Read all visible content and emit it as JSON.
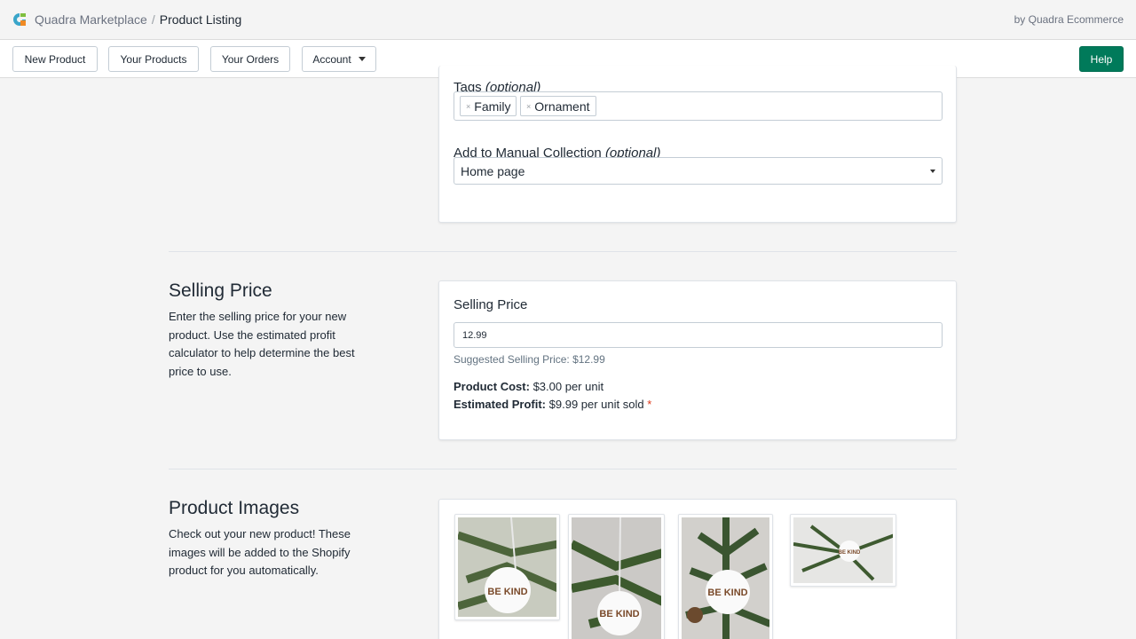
{
  "header": {
    "breadcrumb_parent": "Quadra Marketplace",
    "breadcrumb_separator": "/",
    "breadcrumb_current": "Product Listing",
    "byline": "by Quadra Ecommerce"
  },
  "nav": {
    "new_product": "New Product",
    "your_products": "Your Products",
    "your_orders": "Your Orders",
    "account": "Account",
    "help": "Help"
  },
  "colors": {
    "accent": "#007a5a",
    "required": "#de3618"
  },
  "details_card": {
    "tags_label": "Tags",
    "tags_optional": "(optional)",
    "tags": [
      "Family",
      "Ornament"
    ],
    "tag_remove_symbol": "×",
    "collection_label": "Add to Manual Collection",
    "collection_optional": "(optional)",
    "collection_value": "Home page"
  },
  "selling_price": {
    "section_title": "Selling Price",
    "section_desc": "Enter the selling price for your new product. Use the estimated profit calculator to help determine the best price to use.",
    "field_label": "Selling Price",
    "value": "12.99",
    "suggested": "Suggested Selling Price: $12.99",
    "cost_label": "Product Cost:",
    "cost_value": "$3.00 per unit",
    "profit_label": "Estimated Profit:",
    "profit_value": "$9.99 per unit sold",
    "required_mark": "*"
  },
  "product_images": {
    "section_title": "Product Images",
    "section_desc": "Check out your new product! These images will be added to the Shopify product for you automatically.",
    "images": [
      {
        "icon": "ornament-photo-1",
        "ornament_text": "BE KIND"
      },
      {
        "icon": "ornament-photo-2",
        "ornament_text": "BE KIND"
      },
      {
        "icon": "ornament-photo-3",
        "ornament_text": "BE KIND"
      },
      {
        "icon": "ornament-photo-4",
        "ornament_text": "BE KIND"
      }
    ]
  }
}
